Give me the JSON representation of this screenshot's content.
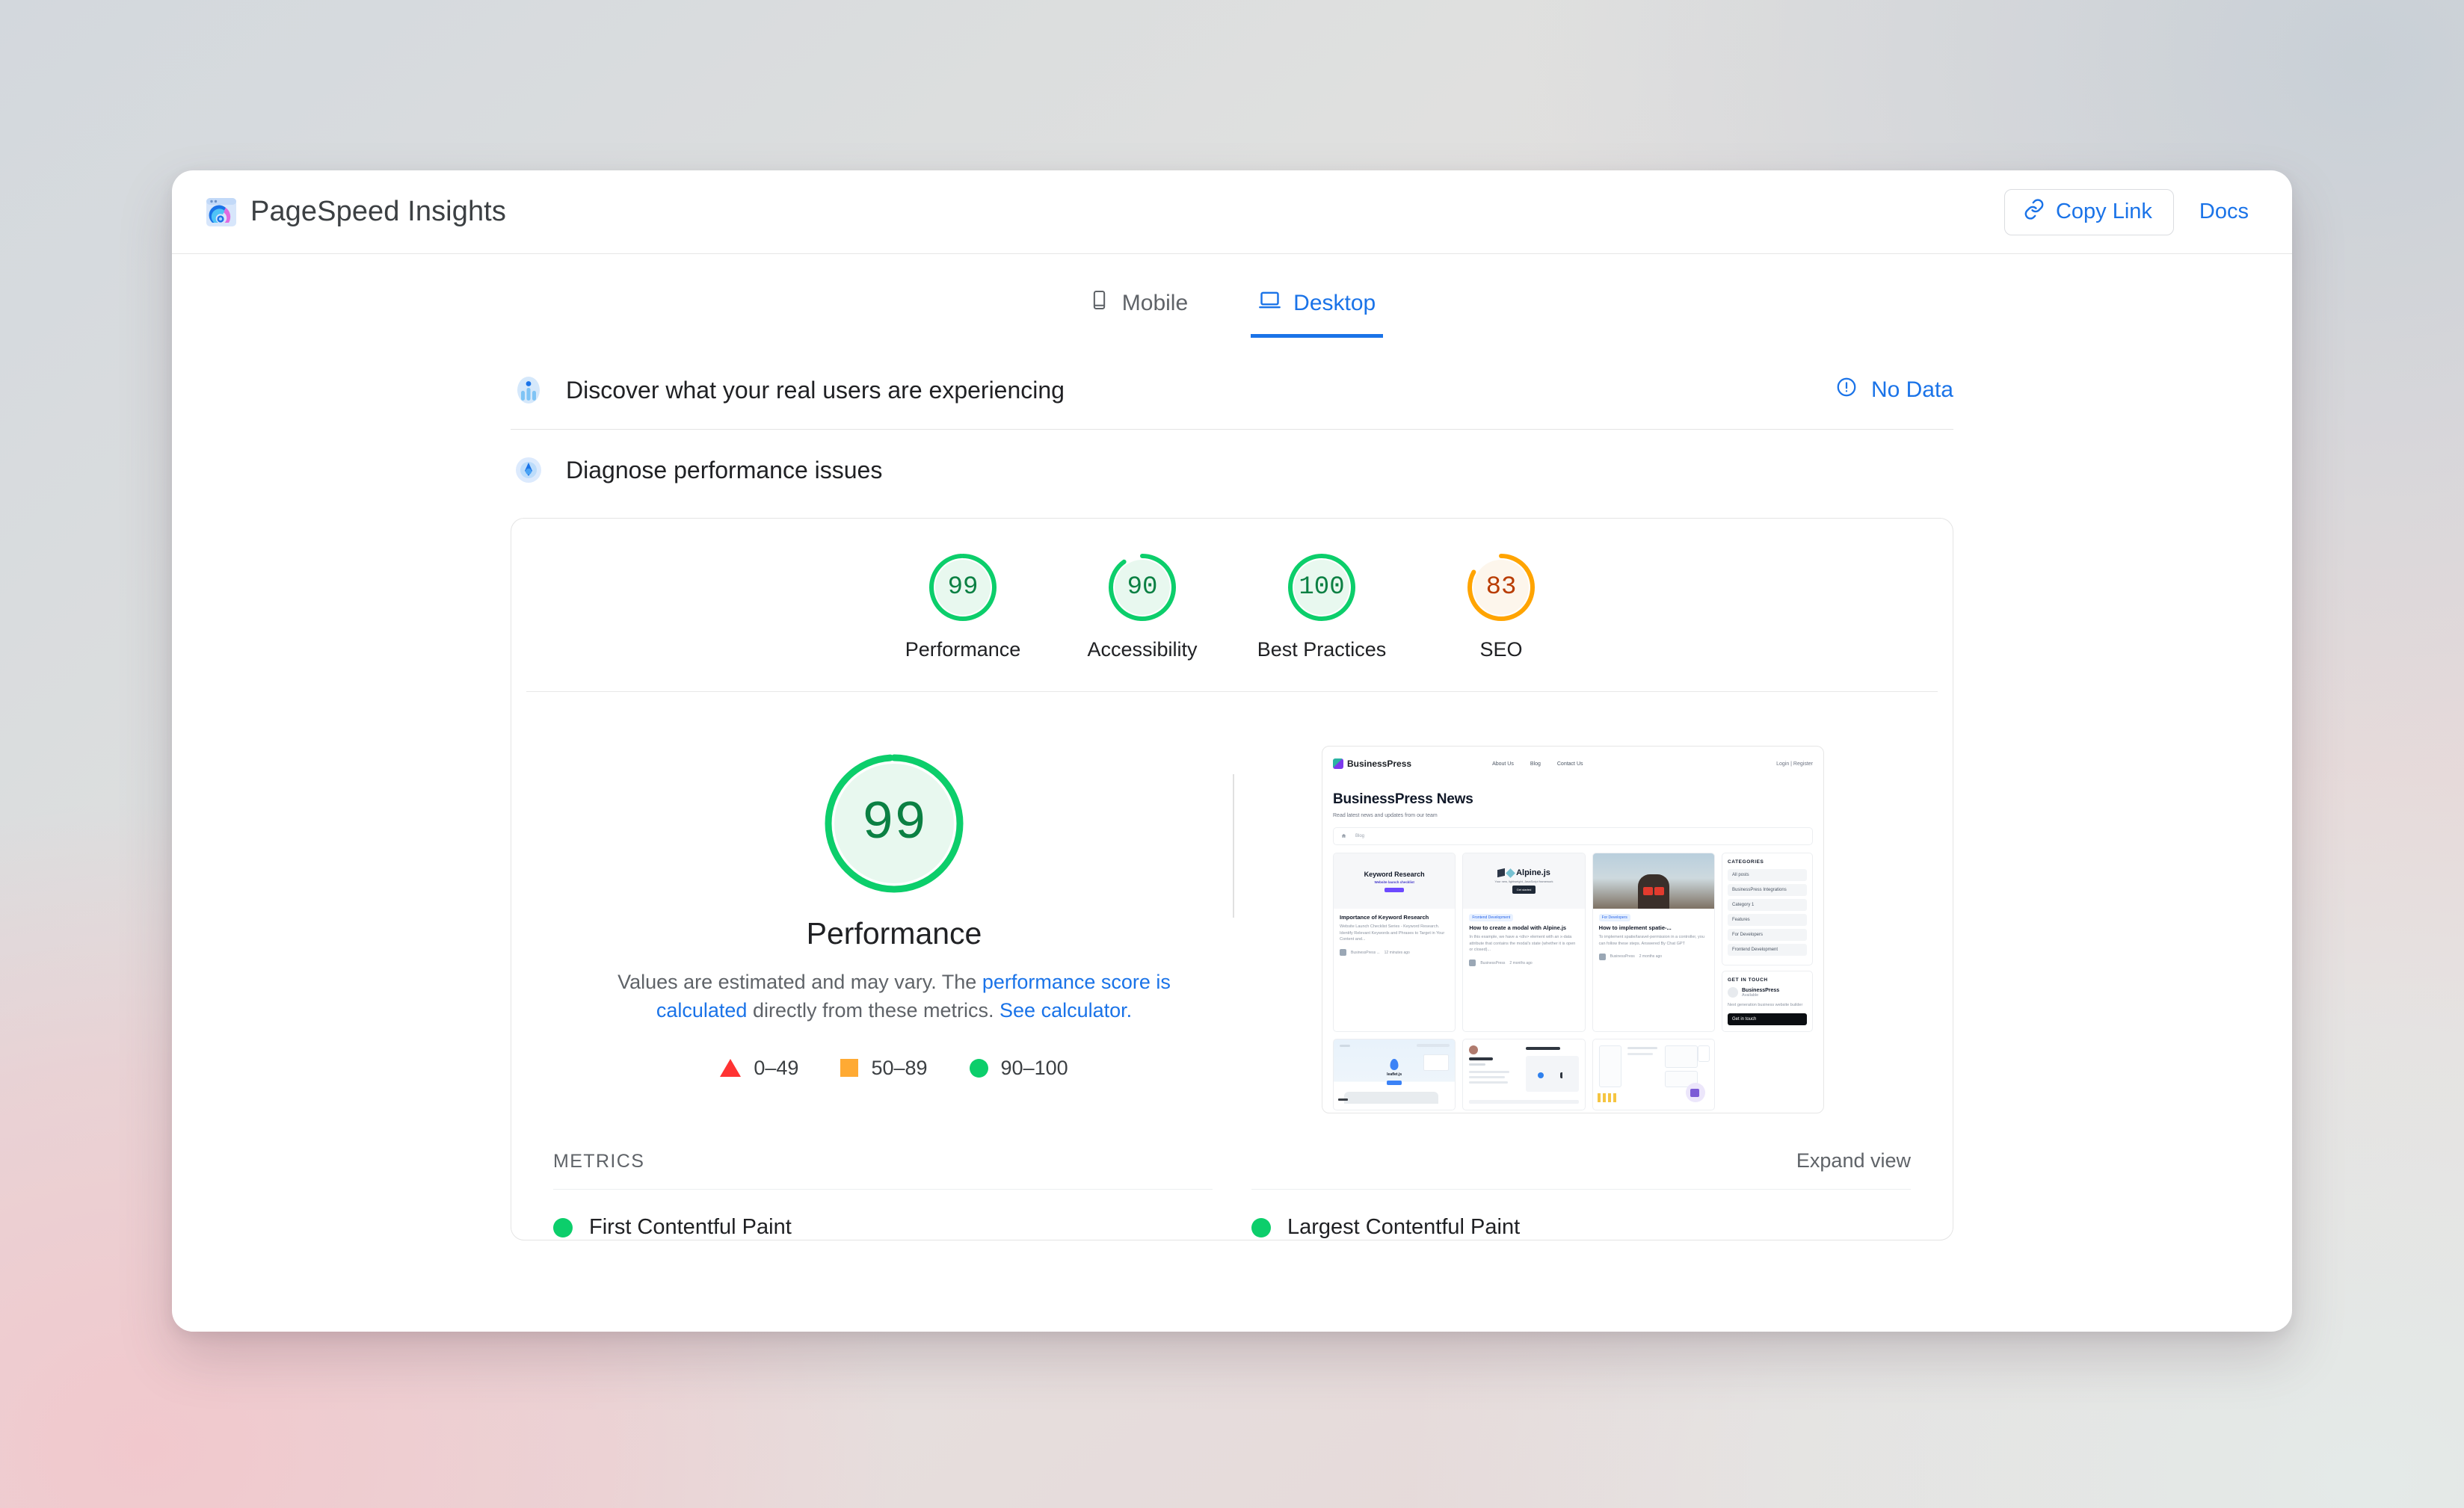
{
  "app": {
    "title": "PageSpeed Insights",
    "logo_icon": "pagespeed-logo-icon"
  },
  "topbar": {
    "copy_link_label": "Copy Link",
    "copy_link_icon": "link-icon",
    "docs_label": "Docs"
  },
  "tabs": [
    {
      "label": "Mobile",
      "icon": "mobile-icon",
      "active": false
    },
    {
      "label": "Desktop",
      "icon": "desktop-icon",
      "active": true
    }
  ],
  "field_section": {
    "icon": "real-users-icon",
    "title": "Discover what your real users are experiencing",
    "status_icon": "info-icon",
    "status_label": "No Data"
  },
  "lab_section": {
    "icon": "diagnose-icon",
    "title": "Diagnose performance issues"
  },
  "category_scores": [
    {
      "label": "Performance",
      "value": 99,
      "color": "#0cce6b",
      "text_color": "#0b8043",
      "fill": "#e8f8ef"
    },
    {
      "label": "Accessibility",
      "value": 90,
      "color": "#0cce6b",
      "text_color": "#0b8043",
      "fill": "#e8f8ef"
    },
    {
      "label": "Best Practices",
      "value": 100,
      "color": "#0cce6b",
      "text_color": "#0b8043",
      "fill": "#e8f8ef"
    },
    {
      "label": "SEO",
      "value": 83,
      "color": "#ffa400",
      "text_color": "#b93c00",
      "fill": "#fdf6ec"
    }
  ],
  "summary": {
    "score": 99,
    "score_color": "#0cce6b",
    "score_fill": "#e8f8ef",
    "title": "Performance",
    "desc_part1": "Values are estimated and may vary. The ",
    "desc_link1": "performance score is calculated",
    "desc_part2": " directly from these metrics. ",
    "desc_link2": "See calculator.",
    "legend": [
      {
        "icon": "triangle-red-icon",
        "label": "0–49",
        "color": "#ff3333"
      },
      {
        "icon": "square-orange-icon",
        "label": "50–89",
        "color": "#ffaa33"
      },
      {
        "icon": "circle-green-icon",
        "label": "90–100",
        "color": "#0cce6b"
      }
    ]
  },
  "thumbnail": {
    "site_name": "BusinessPress",
    "nav": [
      "About Us",
      "Blog",
      "Contact Us"
    ],
    "nav_right": "Login | Register",
    "headline": "BusinessPress News",
    "subhead": "Read latest news and updates from our team",
    "breadcrumb": [
      "home-icon",
      "Blog"
    ],
    "posts": [
      {
        "image_title": "Keyword Research",
        "image_sub": "Website launch checklist",
        "tag": "",
        "title": "Importance of Keyword Research",
        "excerpt": "Website Launch Checklist Series - Keyword Research. Identify Relevant Keywords and Phrases to Target in Your Content and...",
        "author": "BusinessPress ...",
        "time": "12 minutes ago"
      },
      {
        "image_title": "Alpine.js",
        "image_sub": "Your new, lightweight, JavaScript framework",
        "tag": "Frontend Development",
        "title": "How to create a modal with Alpine.js",
        "excerpt": "In this example, we have a <div> element with an x-data attribute that contains the modal's state (whether it is open or closed)...",
        "author": "BusinessPress",
        "time": "2 months ago"
      },
      {
        "image_title": "",
        "image_sub": "",
        "tag": "For Developers",
        "title": "How to implement spatie-...",
        "excerpt": "To implement spatie/laravel-permission in a controller, you can follow these steps. Answered By Chat GPT",
        "author": "BusinessPress",
        "time": "2 months ago"
      }
    ],
    "categories_heading": "CATEGORIES",
    "categories": [
      "All posts",
      "BusinessPress Integrations",
      "Category 1",
      "Features",
      "For Developers",
      "Frontend Development"
    ],
    "touch_heading": "GET IN TOUCH",
    "touch_name": "BusinessPress",
    "touch_status": "Available",
    "touch_desc": "Next generation business website builder",
    "touch_button": "Get in touch"
  },
  "metrics": {
    "heading": "METRICS",
    "expand_label": "Expand view",
    "items": [
      {
        "name": "First Contentful Paint",
        "status_color": "#0cce6b"
      },
      {
        "name": "Largest Contentful Paint",
        "status_color": "#0cce6b"
      }
    ]
  }
}
